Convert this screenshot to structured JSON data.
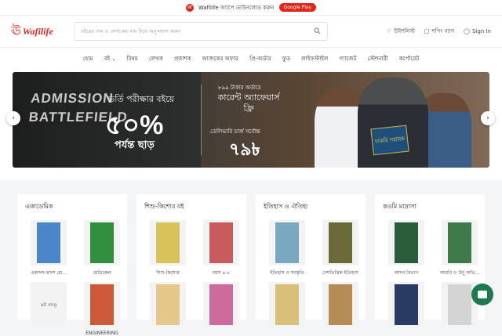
{
  "topbar": {
    "text": "Wafilife অ্যাপে ডাউনলোড করুন",
    "button": "Google Play"
  },
  "header": {
    "logo": "Wafilife",
    "search_placeholder": "বইয়ের নাম ও লেখকের নাম দিয়ে অনুসন্ধান করুন",
    "wishlist": "উইশলিস্ট",
    "cart": "শপিং ব্যাগ",
    "signin": "Sign In"
  },
  "nav": [
    "হোম",
    "বই",
    "বিষয়",
    "লেখক",
    "প্রকাশক",
    "আজকের অফার",
    "প্রি-অর্ডার",
    "ফুড",
    "লাইফস্টাইল",
    "গ্যাজেট",
    "স্টেশনারী",
    "কর্পোরেট"
  ],
  "banner": {
    "headline": "ADMISSION BATTLEFIELD",
    "offer_line1": "ভর্তি পরীক্ষার বইয়ে",
    "offer_percent": "৫০%",
    "offer_line3": "পর্যন্ত ছাড়",
    "mid_small": "৮৯৯ টাকার অর্ডারে",
    "mid_title": "কারেন্ট অ্যাফেয়ার্স ফ্রি",
    "mid_small2": "ডেলিভারি চার্জ সর্বোচ্চ",
    "mid_price": "৭৯৳",
    "book_prop": "চাকরি সহায়ক"
  },
  "sections": [
    {
      "title": "একাডেমিক",
      "books": [
        {
          "name": "একাদশ-দ্বাদশ শ্রে...",
          "color": "#4a86c8"
        },
        {
          "name": "মেডিকেল",
          "color": "#2f8f3e"
        },
        {
          "name": "alt img",
          "color": ""
        },
        {
          "name": "ENGINEERING",
          "color": "#cc5a3a"
        }
      ]
    },
    {
      "title": "শিশু-কিশোর বই",
      "books": [
        {
          "name": "শিশু-কিশোর",
          "color": "#d8c25a"
        },
        {
          "name": "বয়স ৪-৮",
          "color": "#c75a5a"
        },
        {
          "name": "",
          "color": "#e4c88a"
        },
        {
          "name": "",
          "color": "#cc6b9b"
        }
      ]
    },
    {
      "title": "ইতিহাস ও ঐতিহ্য",
      "books": [
        {
          "name": "ইতিহাস ও সংস্কৃতি",
          "color": "#7aa8c0"
        },
        {
          "name": "দেশভিত্তিক ইতিহাস",
          "color": "#6b6b3a"
        },
        {
          "name": "",
          "color": "#d9c07a"
        },
        {
          "name": "",
          "color": "#b58c55"
        }
      ]
    },
    {
      "title": "কওমি মাদ্রাসা",
      "books": [
        {
          "name": "আদব বিভাগ",
          "color": "#2c5d3a"
        },
        {
          "name": "আরবি ও উর্দু অভি...",
          "color": "#3f7a4b"
        },
        {
          "name": "",
          "color": "#2a3b63"
        },
        {
          "name": "",
          "color": "#d4d4d4"
        }
      ]
    }
  ],
  "colors": {
    "brand": "#e1251b",
    "chat": "#1e7a4e"
  }
}
